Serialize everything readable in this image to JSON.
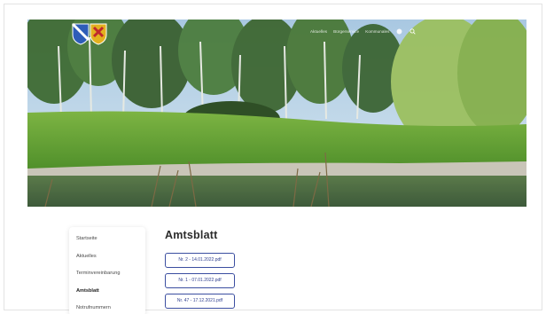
{
  "header": {
    "logo_name": "coat-of-arms-logo",
    "nav": [
      {
        "label": "Aktuelles"
      },
      {
        "label": "Bürgerservice"
      },
      {
        "label": "Kommunales"
      }
    ],
    "icons": [
      "user-icon",
      "search-icon"
    ]
  },
  "sidebar": {
    "items": [
      {
        "label": "Startseite"
      },
      {
        "label": "Aktuelles"
      },
      {
        "label": "Terminvereinbarung"
      },
      {
        "label": "Amtsblatt",
        "active": true
      },
      {
        "label": "Notrufnummern"
      }
    ]
  },
  "main": {
    "title": "Amtsblatt",
    "documents": [
      {
        "label": "Nr. 2 - 14.01.2022.pdf"
      },
      {
        "label": "Nr. 1 - 07.01.2022.pdf"
      },
      {
        "label": "Nr. 47 - 17.12.2021.pdf"
      }
    ]
  },
  "colors": {
    "accent": "#3b4ea0",
    "text": "#2b2b2b"
  }
}
